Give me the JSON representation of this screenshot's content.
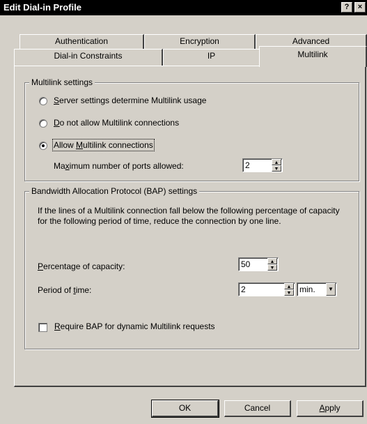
{
  "window": {
    "title": "Edit Dial-in Profile",
    "help_label": "?",
    "close_label": "×"
  },
  "tabs": {
    "row_back": [
      "Authentication",
      "Encryption",
      "Advanced"
    ],
    "row_front": [
      "Dial-in Constraints",
      "IP",
      "Multilink"
    ],
    "active": "Multilink"
  },
  "multilink": {
    "legend": "Multilink settings",
    "options": [
      {
        "pre": "",
        "key": "S",
        "post": "erver settings determine Multilink usage",
        "selected": false
      },
      {
        "pre": "",
        "key": "D",
        "post": "o not allow Multilink connections",
        "selected": false
      },
      {
        "pre": "Allow ",
        "key": "M",
        "post": "ultilink connections",
        "selected": true
      }
    ],
    "max_ports_pre": "Ma",
    "max_ports_key": "x",
    "max_ports_post": "imum number of ports allowed:",
    "max_ports_value": "2"
  },
  "bap": {
    "legend": "Bandwidth Allocation Protocol (BAP) settings",
    "description": "If the lines of a Multilink connection fall below the following percentage of capacity for the following period of time, reduce the connection by one line.",
    "percentage_pre": "",
    "percentage_key": "P",
    "percentage_post": "ercentage of capacity:",
    "percentage_value": "50",
    "period_pre": "Period of ",
    "period_key": "t",
    "period_post": "ime:",
    "period_value": "2",
    "period_unit": "min.",
    "require_pre": "",
    "require_key": "R",
    "require_post": "equire BAP for dynamic Multilink requests",
    "require_checked": false
  },
  "buttons": {
    "ok": "OK",
    "cancel": "Cancel",
    "apply_key": "A",
    "apply_post": "pply"
  }
}
